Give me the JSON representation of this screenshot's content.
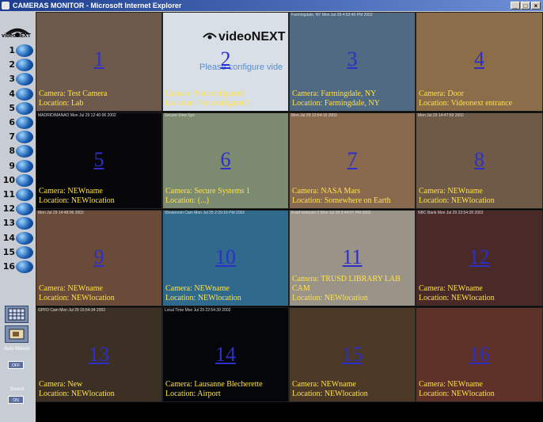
{
  "window": {
    "title": "CAMERAS MONITOR - Microsoft Internet Explorer",
    "buttons": [
      "_",
      "□",
      "×"
    ]
  },
  "sidebar": {
    "logo_text": "videoNEXT",
    "camera_numbers": [
      "1",
      "2",
      "3",
      "4",
      "5",
      "6",
      "7",
      "8",
      "9",
      "10",
      "11",
      "12",
      "13",
      "14",
      "15",
      "16"
    ],
    "auto_motion_label": "Auto Motion:",
    "auto_motion_value": "OFF",
    "sound_label": "Sound:",
    "sound_value": "ON"
  },
  "cameras": [
    {
      "num": "1",
      "timestamp": "",
      "camera": "Camera: Test Camera",
      "location": "Location: Lab",
      "bg": "#6e5a4c"
    },
    {
      "num": "2",
      "timestamp": "",
      "camera": "Camera: Not configured!",
      "location": "Location: Not configured!",
      "bg": "#d8dfe6",
      "logo": "videoNEXT",
      "message": "Please configure vide"
    },
    {
      "num": "3",
      "timestamp": "Farmingdale, NY   Mon Jul 29    4:53:40 PM 2002",
      "camera": "Camera: Farmingdale, NY",
      "location": "Location: Farmingdale, NY",
      "bg": "#4f6a82"
    },
    {
      "num": "4",
      "timestamp": "",
      "camera": "Camera: Door",
      "location": "Location: Videonext entrance",
      "bg": "#8b6d4a"
    },
    {
      "num": "5",
      "timestamp": "MADRID/MANAO Mon Jul 29 12:40:06 2002",
      "camera": "Camera: NEWname",
      "location": "Location: NEWlocation",
      "bg": "#07070a"
    },
    {
      "num": "6",
      "timestamp": "Secure View Sys",
      "camera": "Camera: Secure Systems 1",
      "location": "Location: (...)",
      "bg": "#7c8a70"
    },
    {
      "num": "7",
      "timestamp": "Mon Jul 29 13:54:10 2002",
      "camera": "Camera: NASA Mars",
      "location": "Location: Somewhere on Earth",
      "bg": "#8a6a4e"
    },
    {
      "num": "8",
      "timestamp": "Mon Jul 29 14:47:59 2002",
      "camera": "Camera: NEWname",
      "location": "Location: NEWlocation",
      "bg": "#6f5a48"
    },
    {
      "num": "9",
      "timestamp": "Mon Jul 29 14:48:06 2002",
      "camera": "Camera: NEWname",
      "location": "Location: NEWlocation",
      "bg": "#6a4a38"
    },
    {
      "num": "10",
      "timestamp": "Showroom Cam   Mon Jul 25  2:20:16 PM  2002",
      "camera": "Camera: NEWname",
      "location": "Location: NEWlocation",
      "bg": "#2f6a8c"
    },
    {
      "num": "11",
      "timestamp": "trusd webcam 2   Mon Jul 29    3:44:07 PM  2002",
      "camera": "Camera: TRUSD LIBRARY LAB",
      "camera2": "CAM",
      "location": "Location: NEWlocation",
      "bg": "#9a9488"
    },
    {
      "num": "12",
      "timestamp": "NBC Bank  Mon Jul 29  23:54:28  2002",
      "camera": "Camera: NEWname",
      "location": "Location: NEWlocation",
      "bg": "#4a2a28"
    },
    {
      "num": "13",
      "timestamp": "GPFD Cam Mon Jul 29 15:54:34 2002",
      "camera": "Camera: New",
      "location": "Location: NEWlocation",
      "bg": "#3c3024"
    },
    {
      "num": "14",
      "timestamp": "Local Time  Mon Jul 29   22:54:39  2002",
      "camera": "Camera: Lausanne Blecherette",
      "location": "Location: Airport",
      "bg": "#05060a"
    },
    {
      "num": "15",
      "timestamp": "",
      "camera": "Camera: NEWname",
      "location": "Location: NEWlocation",
      "bg": "#4c3826"
    },
    {
      "num": "16",
      "timestamp": "",
      "camera": "Camera: NEWname",
      "location": "Location: NEWlocation",
      "bg": "#5e3228"
    }
  ]
}
